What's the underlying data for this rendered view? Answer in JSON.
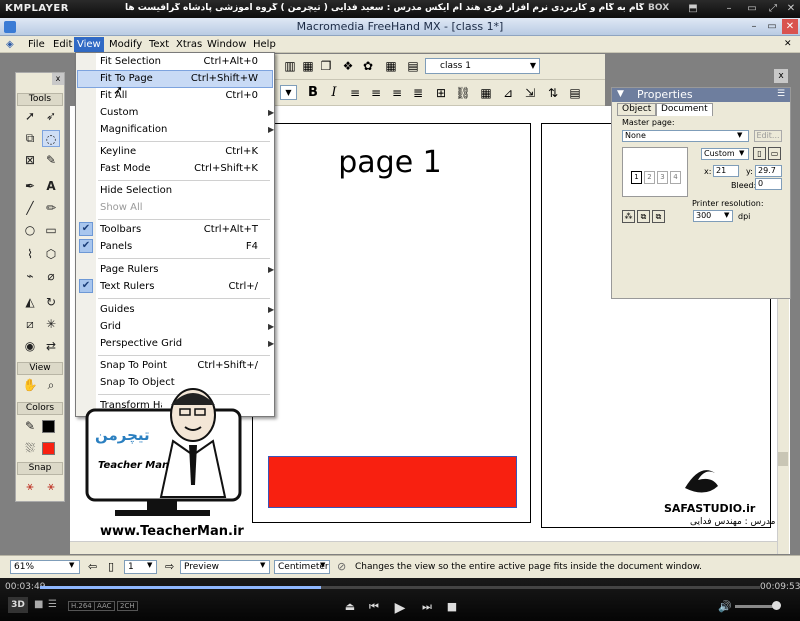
{
  "player": {
    "brand": "KMPLAYER",
    "title": "مجموعه آموزش جامع ، گام به گام و کاربردی نرم افزار فری هند ام ایکس   مدرس : سعید فدایی ( تیچرمن ) گروه آموزشی پادشاه گرافیست ها",
    "box_label": "BOX",
    "time_elapsed": "00:03:49",
    "time_total": "00:09:53",
    "progress": 0.39,
    "volume": 0.92,
    "mode_label": "3D",
    "badges": [
      "H.264",
      "AAC",
      "2CH"
    ]
  },
  "app": {
    "title": "Macromedia FreeHand MX - [class 1*]",
    "menu": [
      "File",
      "Edit",
      "View",
      "Modify",
      "Text",
      "Xtras",
      "Window",
      "Help"
    ],
    "class_select": "class 1"
  },
  "view_menu": {
    "items": [
      {
        "label": "Fit Selection",
        "shortcut": "Ctrl+Alt+0"
      },
      {
        "label": "Fit To Page",
        "shortcut": "Ctrl+Shift+W"
      },
      {
        "label": "Fit All",
        "shortcut": "Ctrl+0"
      },
      {
        "label": "Custom",
        "shortcut": ""
      },
      {
        "label": "Magnification",
        "shortcut": ""
      },
      {
        "label": "Keyline",
        "shortcut": "Ctrl+K"
      },
      {
        "label": "Fast Mode",
        "shortcut": "Ctrl+Shift+K"
      },
      {
        "label": "Hide Selection",
        "shortcut": ""
      },
      {
        "label": "Show All",
        "shortcut": ""
      },
      {
        "label": "Toolbars",
        "shortcut": "Ctrl+Alt+T"
      },
      {
        "label": "Panels",
        "shortcut": "F4"
      },
      {
        "label": "Page Rulers",
        "shortcut": ""
      },
      {
        "label": "Text Rulers",
        "shortcut": "Ctrl+/"
      },
      {
        "label": "Guides",
        "shortcut": ""
      },
      {
        "label": "Grid",
        "shortcut": ""
      },
      {
        "label": "Perspective Grid",
        "shortcut": ""
      },
      {
        "label": "Snap To Point",
        "shortcut": "Ctrl+Shift+/"
      },
      {
        "label": "Snap To Object",
        "shortcut": ""
      },
      {
        "label": "Transform Handles",
        "shortcut": ""
      }
    ]
  },
  "tools": {
    "title": "Tools",
    "view_title": "View",
    "colors_title": "Colors",
    "snap_title": "Snap"
  },
  "properties": {
    "title": "Properties",
    "tabs": [
      "Object",
      "Document"
    ],
    "master_page_label": "Master page:",
    "master_page_value": "None",
    "edit_button": "Edit...",
    "size_select": "Custom",
    "x_label": "x:",
    "x_value": "21",
    "y_label": "y:",
    "y_value": "29.7",
    "bleed_label": "Bleed:",
    "bleed_value": "0",
    "thumbs": [
      "1",
      "2",
      "3",
      "4"
    ],
    "printer_label": "Printer resolution:",
    "printer_value": "300",
    "dpi_label": "dpi"
  },
  "document": {
    "page_text": "page 1"
  },
  "status": {
    "zoom": "61%",
    "page": "1",
    "mode": "Preview",
    "units": "Centimeters",
    "message": "Changes the view so the entire active page fits inside the document window."
  },
  "logos": {
    "teacher_name": "Teacher Man",
    "website": "www.TeacherMan.ir",
    "safa": "SAFASTUDIO.ir",
    "safa_sub": "مدرس : مهندس فدایی"
  },
  "colors": {
    "accent": "#316ac5",
    "red_rect": "#f82010"
  }
}
